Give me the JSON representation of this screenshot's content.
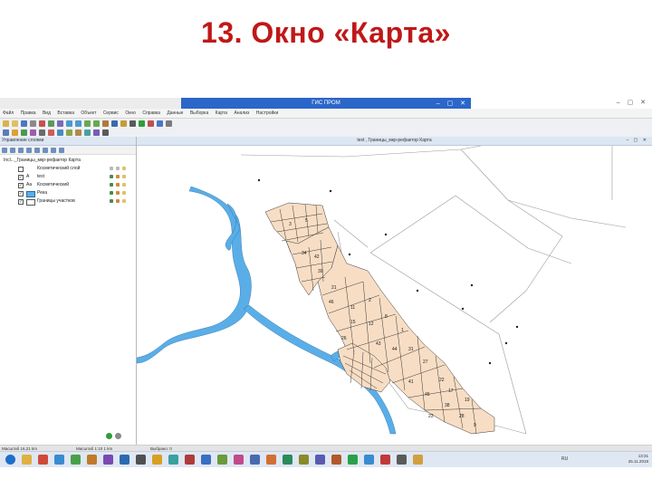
{
  "slide": {
    "title": "13. Окно «Карта»"
  },
  "app": {
    "window_title": "ГИС ПРОМ",
    "menu": [
      "Файл",
      "Правка",
      "Вид",
      "Вставка",
      "Объект",
      "Сервис",
      "Окно",
      "Справка",
      "Данные",
      "Выборка",
      "Карта",
      "Анализ",
      "Настройки"
    ]
  },
  "layers_panel": {
    "title": "Управление слоями",
    "root": "Incl..._Границы_мкр-рефактор Карта",
    "layers": [
      {
        "name": "Косметический слой",
        "checked": false,
        "legend": "none"
      },
      {
        "name": "text",
        "checked": true,
        "legend": "text"
      },
      {
        "name": "Косметический",
        "checked": true,
        "legend": "text"
      },
      {
        "name": "Река",
        "checked": true,
        "legend": "water"
      },
      {
        "name": "Границы участков",
        "checked": true,
        "legend": "parcel"
      }
    ]
  },
  "map_window": {
    "title": "text ,  Границы_мкр-рефактор Карта"
  },
  "status": {
    "zoom": "Масштаб 16,21 km",
    "scale": "Масштаб 1:10 1 km",
    "layer": "Выбрано: 0"
  },
  "taskbar": {
    "lang": "RU",
    "time": "13:31",
    "date": "25.11.2019"
  },
  "colors": {
    "title": "#c01818",
    "water": "#5aaee8",
    "parcel_fill": "#f7ddc4",
    "parcel_border": "#3a3a3a",
    "window_title_bar": "#2b66c9"
  },
  "parcel_numbers": [
    "34",
    "21",
    "11",
    "2",
    "15",
    "12",
    "8",
    "1",
    "26",
    "43",
    "44",
    "31",
    "27",
    "22",
    "41",
    "45",
    "38",
    "23",
    "28",
    "9",
    "17",
    "19",
    "39",
    "42",
    "46",
    "3",
    "5"
  ],
  "point_markers": 10
}
